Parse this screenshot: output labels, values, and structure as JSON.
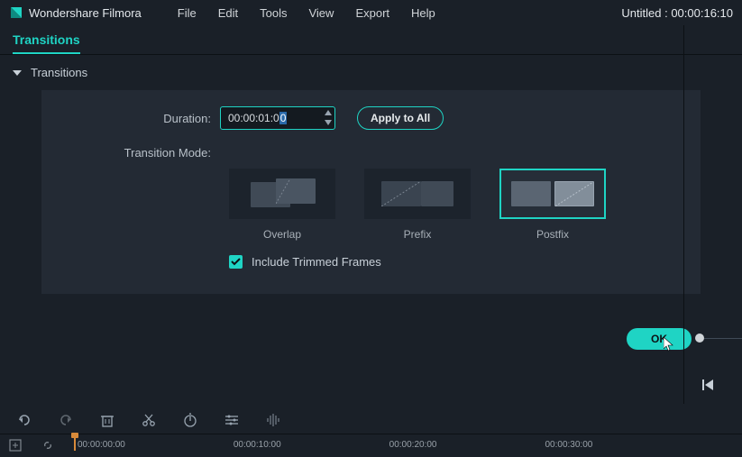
{
  "app": {
    "name": "Wondershare Filmora"
  },
  "menu": {
    "file": "File",
    "edit": "Edit",
    "tools": "Tools",
    "view": "View",
    "export": "Export",
    "help": "Help"
  },
  "project": {
    "status": "Untitled : 00:00:16:10"
  },
  "tab": {
    "transitions": "Transitions"
  },
  "section": {
    "title": "Transitions"
  },
  "duration": {
    "label": "Duration:",
    "prefix": "00:00:01:0",
    "selected_digit": "0"
  },
  "apply": {
    "label": "Apply to All"
  },
  "mode": {
    "label": "Transition Mode:",
    "overlap": "Overlap",
    "prefix": "Prefix",
    "postfix": "Postfix"
  },
  "include": {
    "label": "Include Trimmed Frames",
    "checked": true
  },
  "ok": {
    "label": "OK"
  },
  "timeline": {
    "t0": "00:00:00:00",
    "t1": "00:00:10:00",
    "t2": "00:00:20:00",
    "t3": "00:00:30:00"
  }
}
